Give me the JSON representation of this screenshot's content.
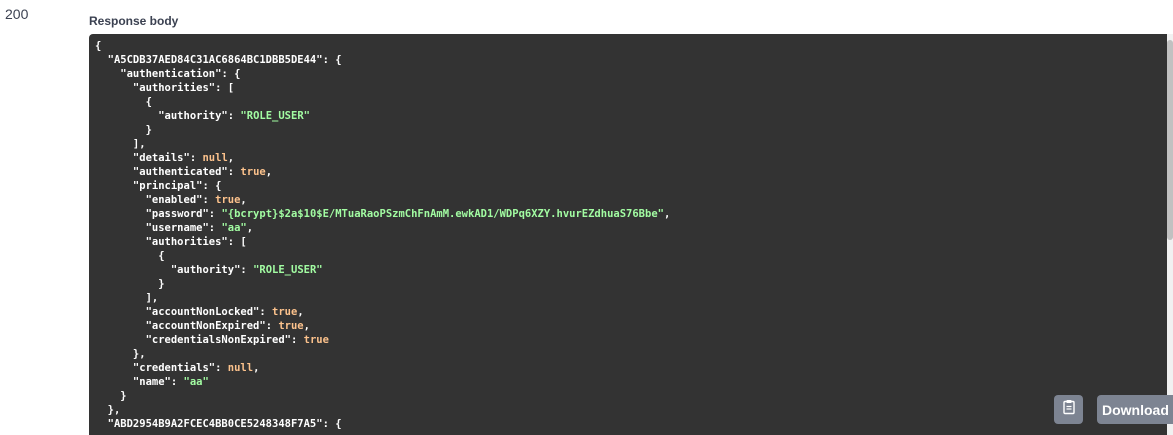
{
  "response": {
    "status_code": "200",
    "body_title": "Response body",
    "body_lines": [
      [
        {
          "t": "punc",
          "v": "{"
        }
      ],
      [
        {
          "t": "key",
          "v": "  \"A5CDB37AED84C31AC6864BC1DBB5DE44\""
        },
        {
          "t": "punc",
          "v": ": {"
        }
      ],
      [
        {
          "t": "key",
          "v": "    \"authentication\""
        },
        {
          "t": "punc",
          "v": ": {"
        }
      ],
      [
        {
          "t": "key",
          "v": "      \"authorities\""
        },
        {
          "t": "punc",
          "v": ": ["
        }
      ],
      [
        {
          "t": "punc",
          "v": "        {"
        }
      ],
      [
        {
          "t": "key",
          "v": "          \"authority\""
        },
        {
          "t": "punc",
          "v": ": "
        },
        {
          "t": "str",
          "v": "\"ROLE_USER\""
        }
      ],
      [
        {
          "t": "punc",
          "v": "        }"
        }
      ],
      [
        {
          "t": "punc",
          "v": "      ],"
        }
      ],
      [
        {
          "t": "key",
          "v": "      \"details\""
        },
        {
          "t": "punc",
          "v": ": "
        },
        {
          "t": "lit",
          "v": "null"
        },
        {
          "t": "punc",
          "v": ","
        }
      ],
      [
        {
          "t": "key",
          "v": "      \"authenticated\""
        },
        {
          "t": "punc",
          "v": ": "
        },
        {
          "t": "lit",
          "v": "true"
        },
        {
          "t": "punc",
          "v": ","
        }
      ],
      [
        {
          "t": "key",
          "v": "      \"principal\""
        },
        {
          "t": "punc",
          "v": ": {"
        }
      ],
      [
        {
          "t": "key",
          "v": "        \"enabled\""
        },
        {
          "t": "punc",
          "v": ": "
        },
        {
          "t": "lit",
          "v": "true"
        },
        {
          "t": "punc",
          "v": ","
        }
      ],
      [
        {
          "t": "key",
          "v": "        \"password\""
        },
        {
          "t": "punc",
          "v": ": "
        },
        {
          "t": "str",
          "v": "\"{bcrypt}$2a$10$E/MTuaRaoPSzmChFnAmM.ewkAD1/WDPq6XZY.hvurEZdhuaS76Bbe\""
        },
        {
          "t": "punc",
          "v": ","
        }
      ],
      [
        {
          "t": "key",
          "v": "        \"username\""
        },
        {
          "t": "punc",
          "v": ": "
        },
        {
          "t": "str",
          "v": "\"aa\""
        },
        {
          "t": "punc",
          "v": ","
        }
      ],
      [
        {
          "t": "key",
          "v": "        \"authorities\""
        },
        {
          "t": "punc",
          "v": ": ["
        }
      ],
      [
        {
          "t": "punc",
          "v": "          {"
        }
      ],
      [
        {
          "t": "key",
          "v": "            \"authority\""
        },
        {
          "t": "punc",
          "v": ": "
        },
        {
          "t": "str",
          "v": "\"ROLE_USER\""
        }
      ],
      [
        {
          "t": "punc",
          "v": "          }"
        }
      ],
      [
        {
          "t": "punc",
          "v": "        ],"
        }
      ],
      [
        {
          "t": "key",
          "v": "        \"accountNonLocked\""
        },
        {
          "t": "punc",
          "v": ": "
        },
        {
          "t": "lit",
          "v": "true"
        },
        {
          "t": "punc",
          "v": ","
        }
      ],
      [
        {
          "t": "key",
          "v": "        \"accountNonExpired\""
        },
        {
          "t": "punc",
          "v": ": "
        },
        {
          "t": "lit",
          "v": "true"
        },
        {
          "t": "punc",
          "v": ","
        }
      ],
      [
        {
          "t": "key",
          "v": "        \"credentialsNonExpired\""
        },
        {
          "t": "punc",
          "v": ": "
        },
        {
          "t": "lit",
          "v": "true"
        }
      ],
      [
        {
          "t": "punc",
          "v": "      },"
        }
      ],
      [
        {
          "t": "key",
          "v": "      \"credentials\""
        },
        {
          "t": "punc",
          "v": ": "
        },
        {
          "t": "lit",
          "v": "null"
        },
        {
          "t": "punc",
          "v": ","
        }
      ],
      [
        {
          "t": "key",
          "v": "      \"name\""
        },
        {
          "t": "punc",
          "v": ": "
        },
        {
          "t": "str",
          "v": "\"aa\""
        }
      ],
      [
        {
          "t": "punc",
          "v": "    }"
        }
      ],
      [
        {
          "t": "punc",
          "v": "  },"
        }
      ],
      [
        {
          "t": "key",
          "v": "  \"ABD2954B9A2FCEC4BB0CE5248348F7A5\""
        },
        {
          "t": "punc",
          "v": ": {"
        }
      ]
    ]
  },
  "actions": {
    "copy_icon": "clipboard-icon",
    "download_label": "Download"
  },
  "colors": {
    "code_background": "#333333",
    "string": "#a2fca2",
    "literal": "#fcc28c",
    "button": "#7d8492"
  }
}
